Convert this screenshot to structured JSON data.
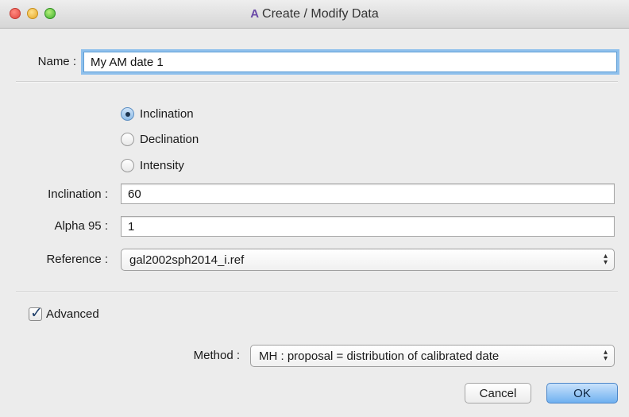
{
  "window": {
    "title": "Create / Modify Data",
    "app_icon_glyph": "A"
  },
  "name_field": {
    "label": "Name :",
    "value": "My AM date 1"
  },
  "measure_type": {
    "options": [
      "Inclination",
      "Declination",
      "Intensity"
    ],
    "selected": "Inclination"
  },
  "inclination_field": {
    "label": "Inclination :",
    "value": "60"
  },
  "alpha95_field": {
    "label": "Alpha 95 :",
    "value": "1"
  },
  "reference_field": {
    "label": "Reference :",
    "value": "gal2002sph2014_i.ref"
  },
  "advanced": {
    "label": "Advanced",
    "checked": true
  },
  "method_field": {
    "label": "Method :",
    "value": "MH : proposal = distribution of calibrated date"
  },
  "buttons": {
    "cancel": "Cancel",
    "ok": "OK"
  },
  "colors": {
    "focus_ring": "#8fc0ec",
    "default_button": "#6fb0f0"
  }
}
